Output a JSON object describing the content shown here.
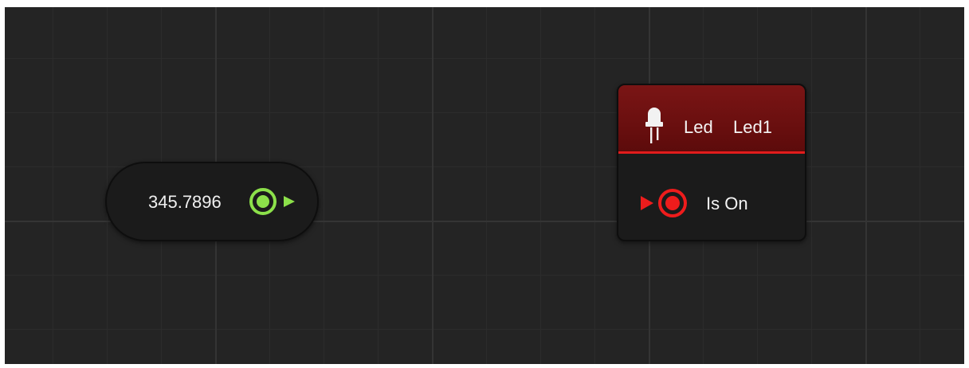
{
  "graph": {
    "value_node": {
      "value": "345.7896",
      "port_color": "#8ce04a"
    },
    "led_node": {
      "icon": "led-icon",
      "type_label": "Led",
      "name_label": "Led1",
      "header_color": "#6a0f0f",
      "accent_color": "#e21c1c",
      "input_port": {
        "label": "Is On",
        "color": "#ee1c1c"
      }
    },
    "connection": {
      "from": "value",
      "to": "Is On",
      "color_start": "#7bd040",
      "color_end": "#e41a1a"
    }
  }
}
